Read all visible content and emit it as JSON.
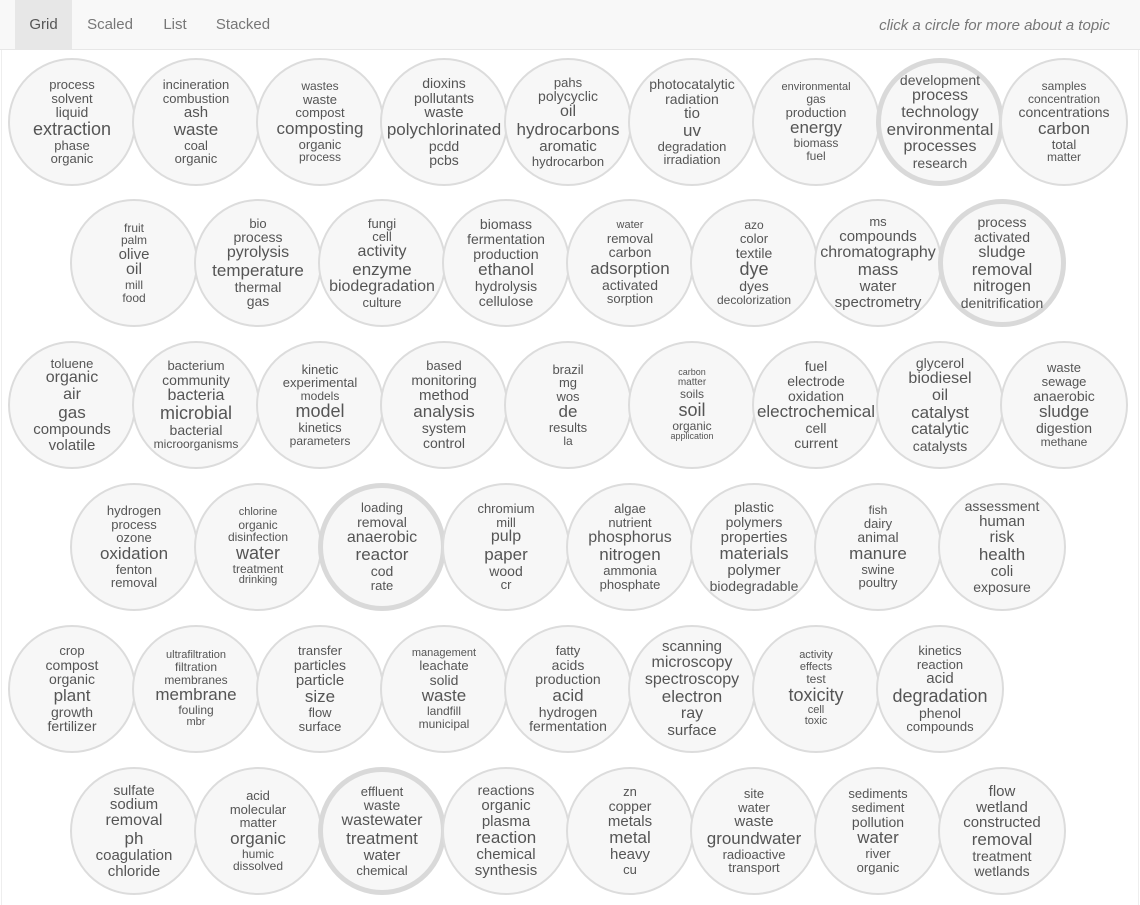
{
  "nav": {
    "tabs": [
      {
        "label": "Grid",
        "active": true
      },
      {
        "label": "Scaled",
        "active": false
      },
      {
        "label": "List",
        "active": false
      },
      {
        "label": "Stacked",
        "active": false
      }
    ],
    "hint": "click a circle for more about a topic"
  },
  "topics": [
    {
      "words": [
        [
          "process",
          13
        ],
        [
          "solvent",
          13
        ],
        [
          "liquid",
          14
        ],
        [
          "extraction",
          18
        ],
        [
          "phase",
          13
        ],
        [
          "organic",
          13
        ]
      ]
    },
    {
      "words": [
        [
          "incineration",
          13
        ],
        [
          "combustion",
          13
        ],
        [
          "ash",
          15
        ],
        [
          "waste",
          17
        ],
        [
          "coal",
          13
        ],
        [
          "organic",
          13
        ]
      ]
    },
    {
      "words": [
        [
          "wastes",
          12
        ],
        [
          "waste",
          13
        ],
        [
          "compost",
          13
        ],
        [
          "composting",
          17
        ],
        [
          "organic",
          13
        ],
        [
          "process",
          12
        ]
      ]
    },
    {
      "words": [
        [
          "dioxins",
          14
        ],
        [
          "pollutants",
          14
        ],
        [
          "waste",
          15
        ],
        [
          "polychlorinated",
          17
        ],
        [
          "pcdd",
          14
        ],
        [
          "pcbs",
          14
        ]
      ]
    },
    {
      "words": [
        [
          "pahs",
          13
        ],
        [
          "polycyclic",
          14
        ],
        [
          "oil",
          16
        ],
        [
          "hydrocarbons",
          17
        ],
        [
          "aromatic",
          15
        ],
        [
          "hydrocarbon",
          13
        ]
      ]
    },
    {
      "words": [
        [
          "photocatalytic",
          14
        ],
        [
          "radiation",
          14
        ],
        [
          "tio",
          15
        ],
        [
          "uv",
          17
        ],
        [
          "degradation",
          13
        ],
        [
          "irradiation",
          13
        ]
      ]
    },
    {
      "words": [
        [
          "environmental",
          11
        ],
        [
          "gas",
          12
        ],
        [
          "production",
          13
        ],
        [
          "energy",
          17
        ],
        [
          "biomass",
          12
        ],
        [
          "fuel",
          12
        ]
      ]
    },
    {
      "thick": true,
      "words": [
        [
          "development",
          14
        ],
        [
          "process",
          16
        ],
        [
          "technology",
          16
        ],
        [
          "environmental",
          17
        ],
        [
          "processes",
          16
        ],
        [
          "research",
          14
        ]
      ]
    },
    {
      "words": [
        [
          "samples",
          12
        ],
        [
          "concentration",
          12
        ],
        [
          "concentrations",
          14
        ],
        [
          "carbon",
          17
        ],
        [
          "total",
          13
        ],
        [
          "matter",
          12
        ]
      ]
    },
    {
      "words": [
        [
          "fruit",
          12
        ],
        [
          "palm",
          12
        ],
        [
          "olive",
          15
        ],
        [
          "oil",
          16
        ],
        [
          "mill",
          12
        ],
        [
          "food",
          12
        ]
      ]
    },
    {
      "words": [
        [
          "bio",
          13
        ],
        [
          "process",
          14
        ],
        [
          "pyrolysis",
          16
        ],
        [
          "temperature",
          17
        ],
        [
          "thermal",
          14
        ],
        [
          "gas",
          14
        ]
      ]
    },
    {
      "words": [
        [
          "fungi",
          13
        ],
        [
          "cell",
          13
        ],
        [
          "activity",
          16
        ],
        [
          "enzyme",
          17
        ],
        [
          "biodegradation",
          16
        ],
        [
          "culture",
          13
        ]
      ]
    },
    {
      "words": [
        [
          "biomass",
          14
        ],
        [
          "fermentation",
          14
        ],
        [
          "production",
          14
        ],
        [
          "ethanol",
          17
        ],
        [
          "hydrolysis",
          14
        ],
        [
          "cellulose",
          14
        ]
      ]
    },
    {
      "words": [
        [
          "water",
          11
        ],
        [
          "removal",
          13
        ],
        [
          "carbon",
          14
        ],
        [
          "adsorption",
          17
        ],
        [
          "activated",
          14
        ],
        [
          "sorption",
          13
        ]
      ]
    },
    {
      "words": [
        [
          "azo",
          12
        ],
        [
          "color",
          13
        ],
        [
          "textile",
          14
        ],
        [
          "dye",
          18
        ],
        [
          "dyes",
          14
        ],
        [
          "decolorization",
          12
        ]
      ]
    },
    {
      "words": [
        [
          "ms",
          13
        ],
        [
          "compounds",
          15
        ],
        [
          "chromatography",
          16
        ],
        [
          "mass",
          17
        ],
        [
          "water",
          15
        ],
        [
          "spectrometry",
          15
        ]
      ]
    },
    {
      "thick": true,
      "words": [
        [
          "process",
          14
        ],
        [
          "activated",
          14
        ],
        [
          "sludge",
          16
        ],
        [
          "removal",
          17
        ],
        [
          "nitrogen",
          16
        ],
        [
          "denitrification",
          14
        ]
      ]
    },
    {
      "words": [
        [
          "toluene",
          13
        ],
        [
          "organic",
          16
        ],
        [
          "air",
          16
        ],
        [
          "gas",
          17
        ],
        [
          "compounds",
          15
        ],
        [
          "volatile",
          15
        ]
      ]
    },
    {
      "words": [
        [
          "bacterium",
          13
        ],
        [
          "community",
          14
        ],
        [
          "bacteria",
          16
        ],
        [
          "microbial",
          18
        ],
        [
          "bacterial",
          14
        ],
        [
          "microorganisms",
          12
        ]
      ]
    },
    {
      "words": [
        [
          "kinetic",
          13
        ],
        [
          "experimental",
          13
        ],
        [
          "models",
          12
        ],
        [
          "model",
          18
        ],
        [
          "kinetics",
          13
        ],
        [
          "parameters",
          12
        ]
      ]
    },
    {
      "words": [
        [
          "based",
          13
        ],
        [
          "monitoring",
          14
        ],
        [
          "method",
          15
        ],
        [
          "analysis",
          17
        ],
        [
          "system",
          14
        ],
        [
          "control",
          14
        ]
      ]
    },
    {
      "words": [
        [
          "brazil",
          13
        ],
        [
          "mg",
          13
        ],
        [
          "wos",
          13
        ],
        [
          "de",
          17
        ],
        [
          "results",
          13
        ],
        [
          "la",
          12
        ]
      ]
    },
    {
      "words": [
        [
          "carbon",
          9
        ],
        [
          "matter",
          10
        ],
        [
          "soils",
          12
        ],
        [
          "soil",
          18
        ],
        [
          "organic",
          12
        ],
        [
          "application",
          9
        ]
      ]
    },
    {
      "words": [
        [
          "fuel",
          14
        ],
        [
          "electrode",
          14
        ],
        [
          "oxidation",
          14
        ],
        [
          "electrochemical",
          17
        ],
        [
          "cell",
          14
        ],
        [
          "current",
          14
        ]
      ]
    },
    {
      "words": [
        [
          "glycerol",
          14
        ],
        [
          "biodiesel",
          16
        ],
        [
          "oil",
          16
        ],
        [
          "catalyst",
          17
        ],
        [
          "catalytic",
          16
        ],
        [
          "catalysts",
          14
        ]
      ]
    },
    {
      "words": [
        [
          "waste",
          13
        ],
        [
          "sewage",
          13
        ],
        [
          "anaerobic",
          14
        ],
        [
          "sludge",
          17
        ],
        [
          "digestion",
          14
        ],
        [
          "methane",
          12
        ]
      ]
    },
    {
      "words": [
        [
          "hydrogen",
          13
        ],
        [
          "process",
          13
        ],
        [
          "ozone",
          13
        ],
        [
          "oxidation",
          17
        ],
        [
          "fenton",
          13
        ],
        [
          "removal",
          13
        ]
      ]
    },
    {
      "words": [
        [
          "chlorine",
          11
        ],
        [
          "organic",
          12
        ],
        [
          "disinfection",
          12
        ],
        [
          "water",
          18
        ],
        [
          "treatment",
          12
        ],
        [
          "drinking",
          11
        ]
      ]
    },
    {
      "thick": true,
      "words": [
        [
          "loading",
          13
        ],
        [
          "removal",
          14
        ],
        [
          "anaerobic",
          16
        ],
        [
          "reactor",
          17
        ],
        [
          "cod",
          14
        ],
        [
          "rate",
          13
        ]
      ]
    },
    {
      "words": [
        [
          "chromium",
          13
        ],
        [
          "mill",
          13
        ],
        [
          "pulp",
          16
        ],
        [
          "paper",
          17
        ],
        [
          "wood",
          14
        ],
        [
          "cr",
          13
        ]
      ]
    },
    {
      "words": [
        [
          "algae",
          13
        ],
        [
          "nutrient",
          13
        ],
        [
          "phosphorus",
          16
        ],
        [
          "nitrogen",
          17
        ],
        [
          "ammonia",
          13
        ],
        [
          "phosphate",
          13
        ]
      ]
    },
    {
      "words": [
        [
          "plastic",
          14
        ],
        [
          "polymers",
          14
        ],
        [
          "properties",
          15
        ],
        [
          "materials",
          17
        ],
        [
          "polymer",
          15
        ],
        [
          "biodegradable",
          14
        ]
      ]
    },
    {
      "words": [
        [
          "fish",
          12
        ],
        [
          "dairy",
          13
        ],
        [
          "animal",
          14
        ],
        [
          "manure",
          17
        ],
        [
          "swine",
          13
        ],
        [
          "poultry",
          13
        ]
      ]
    },
    {
      "words": [
        [
          "assessment",
          14
        ],
        [
          "human",
          15
        ],
        [
          "risk",
          16
        ],
        [
          "health",
          17
        ],
        [
          "coli",
          15
        ],
        [
          "exposure",
          14
        ]
      ]
    },
    {
      "words": [
        [
          "crop",
          13
        ],
        [
          "compost",
          14
        ],
        [
          "organic",
          14
        ],
        [
          "plant",
          17
        ],
        [
          "growth",
          14
        ],
        [
          "fertilizer",
          14
        ]
      ]
    },
    {
      "words": [
        [
          "ultrafiltration",
          11
        ],
        [
          "filtration",
          12
        ],
        [
          "membranes",
          12
        ],
        [
          "membrane",
          17
        ],
        [
          "fouling",
          12
        ],
        [
          "mbr",
          11
        ]
      ]
    },
    {
      "words": [
        [
          "transfer",
          13
        ],
        [
          "particles",
          14
        ],
        [
          "particle",
          15
        ],
        [
          "size",
          17
        ],
        [
          "flow",
          13
        ],
        [
          "surface",
          13
        ]
      ]
    },
    {
      "words": [
        [
          "management",
          11
        ],
        [
          "leachate",
          13
        ],
        [
          "solid",
          14
        ],
        [
          "waste",
          17
        ],
        [
          "landfill",
          12
        ],
        [
          "municipal",
          12
        ]
      ]
    },
    {
      "words": [
        [
          "fatty",
          13
        ],
        [
          "acids",
          14
        ],
        [
          "production",
          14
        ],
        [
          "acid",
          17
        ],
        [
          "hydrogen",
          14
        ],
        [
          "fermentation",
          14
        ]
      ]
    },
    {
      "words": [
        [
          "scanning",
          15
        ],
        [
          "microscopy",
          16
        ],
        [
          "spectroscopy",
          16
        ],
        [
          "electron",
          17
        ],
        [
          "ray",
          16
        ],
        [
          "surface",
          15
        ]
      ]
    },
    {
      "words": [
        [
          "activity",
          11
        ],
        [
          "effects",
          11
        ],
        [
          "test",
          12
        ],
        [
          "toxicity",
          18
        ],
        [
          "cell",
          11
        ],
        [
          "toxic",
          11
        ]
      ]
    },
    {
      "words": [
        [
          "kinetics",
          13
        ],
        [
          "reaction",
          13
        ],
        [
          "acid",
          15
        ],
        [
          "degradation",
          18
        ],
        [
          "phenol",
          14
        ],
        [
          "compounds",
          13
        ]
      ]
    },
    {
      "words": [
        [
          "sulfate",
          14
        ],
        [
          "sodium",
          15
        ],
        [
          "removal",
          16
        ],
        [
          "ph",
          17
        ],
        [
          "coagulation",
          15
        ],
        [
          "chloride",
          15
        ]
      ]
    },
    {
      "words": [
        [
          "acid",
          13
        ],
        [
          "molecular",
          13
        ],
        [
          "matter",
          13
        ],
        [
          "organic",
          17
        ],
        [
          "humic",
          12
        ],
        [
          "dissolved",
          12
        ]
      ]
    },
    {
      "thick": true,
      "words": [
        [
          "effluent",
          13
        ],
        [
          "waste",
          14
        ],
        [
          "wastewater",
          16
        ],
        [
          "treatment",
          17
        ],
        [
          "water",
          15
        ],
        [
          "chemical",
          13
        ]
      ]
    },
    {
      "words": [
        [
          "reactions",
          14
        ],
        [
          "organic",
          15
        ],
        [
          "plasma",
          15
        ],
        [
          "reaction",
          17
        ],
        [
          "chemical",
          15
        ],
        [
          "synthesis",
          15
        ]
      ]
    },
    {
      "words": [
        [
          "zn",
          13
        ],
        [
          "copper",
          14
        ],
        [
          "metals",
          15
        ],
        [
          "metal",
          17
        ],
        [
          "heavy",
          15
        ],
        [
          "cu",
          13
        ]
      ]
    },
    {
      "words": [
        [
          "site",
          13
        ],
        [
          "water",
          13
        ],
        [
          "waste",
          15
        ],
        [
          "groundwater",
          17
        ],
        [
          "radioactive",
          13
        ],
        [
          "transport",
          13
        ]
      ]
    },
    {
      "words": [
        [
          "sediments",
          13
        ],
        [
          "sediment",
          13
        ],
        [
          "pollution",
          14
        ],
        [
          "water",
          17
        ],
        [
          "river",
          13
        ],
        [
          "organic",
          13
        ]
      ]
    },
    {
      "words": [
        [
          "flow",
          15
        ],
        [
          "wetland",
          15
        ],
        [
          "constructed",
          15
        ],
        [
          "removal",
          17
        ],
        [
          "treatment",
          14
        ],
        [
          "wetlands",
          14
        ]
      ]
    }
  ]
}
